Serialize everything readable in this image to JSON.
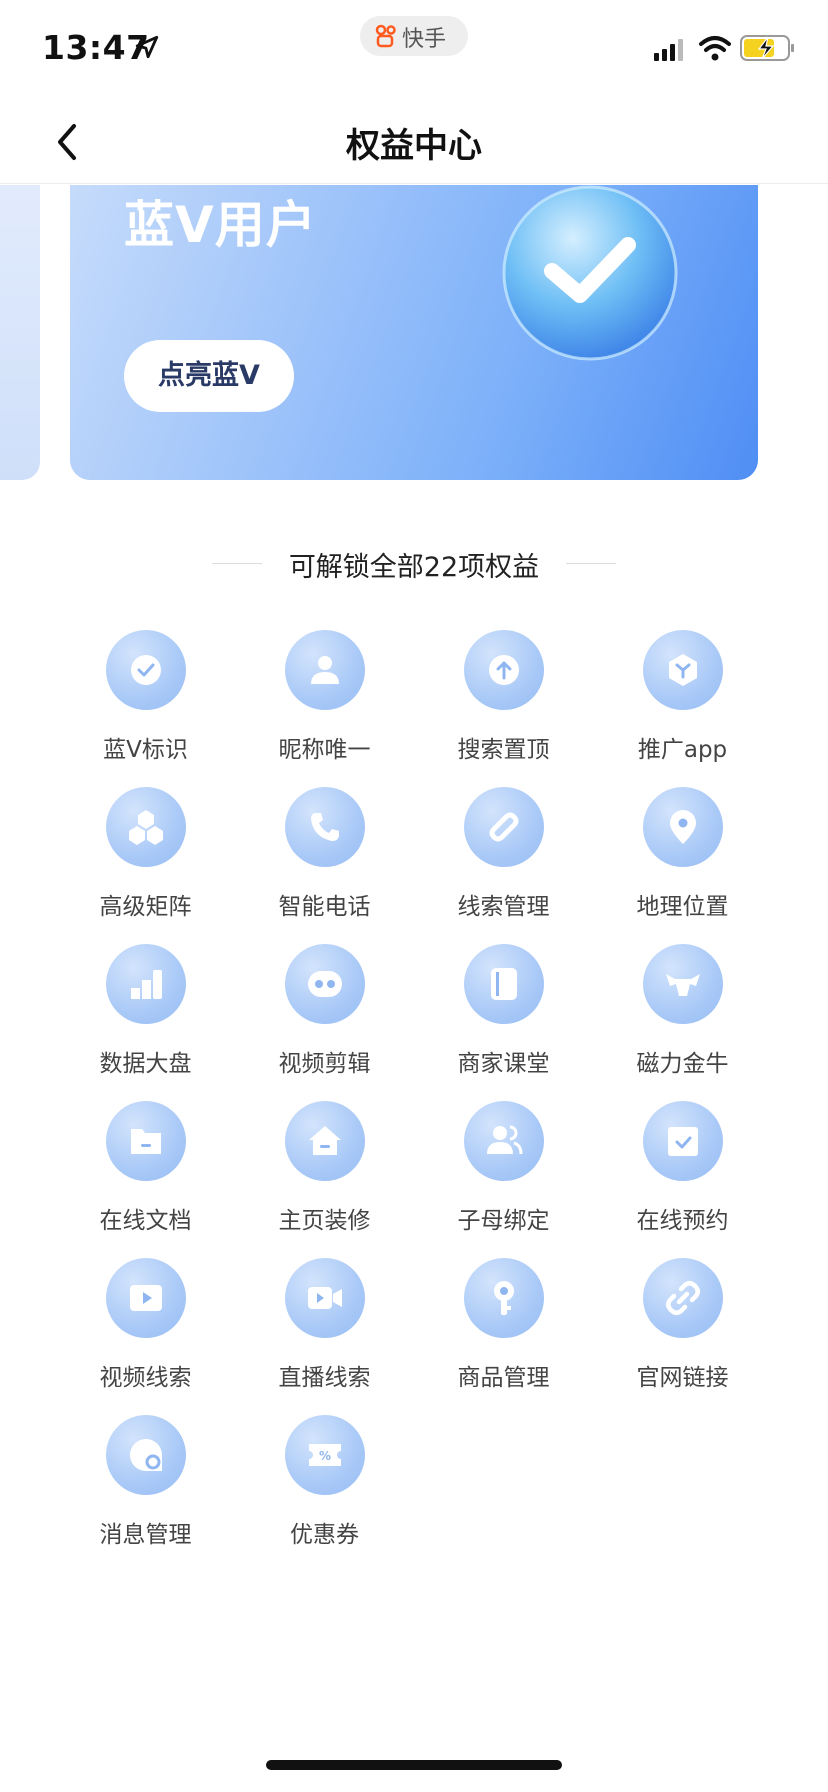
{
  "status_bar": {
    "time": "13:47",
    "app_name": "快手"
  },
  "nav": {
    "title": "权益中心"
  },
  "banner": {
    "title": "蓝V用户",
    "button_label": "点亮蓝V"
  },
  "benefits": {
    "header": "可解锁全部22项权益",
    "items": [
      {
        "label": "蓝V标识",
        "icon": "check-circle-icon"
      },
      {
        "label": "昵称唯一",
        "icon": "user-icon"
      },
      {
        "label": "搜索置顶",
        "icon": "arrow-up-icon"
      },
      {
        "label": "推广app",
        "icon": "box-icon"
      },
      {
        "label": "高级矩阵",
        "icon": "cubes-icon"
      },
      {
        "label": "智能电话",
        "icon": "phone-icon"
      },
      {
        "label": "线索管理",
        "icon": "link-chain-icon"
      },
      {
        "label": "地理位置",
        "icon": "location-pin-icon"
      },
      {
        "label": "数据大盘",
        "icon": "bar-chart-icon"
      },
      {
        "label": "视频剪辑",
        "icon": "film-reel-icon"
      },
      {
        "label": "商家课堂",
        "icon": "book-icon"
      },
      {
        "label": "磁力金牛",
        "icon": "bull-icon"
      },
      {
        "label": "在线文档",
        "icon": "folder-icon"
      },
      {
        "label": "主页装修",
        "icon": "home-icon"
      },
      {
        "label": "子母绑定",
        "icon": "users-icon"
      },
      {
        "label": "在线预约",
        "icon": "calendar-check-icon"
      },
      {
        "label": "视频线索",
        "icon": "play-icon"
      },
      {
        "label": "直播线索",
        "icon": "video-camera-icon"
      },
      {
        "label": "商品管理",
        "icon": "key-icon"
      },
      {
        "label": "官网链接",
        "icon": "link-icon"
      },
      {
        "label": "消息管理",
        "icon": "chat-gear-icon"
      },
      {
        "label": "优惠券",
        "icon": "coupon-icon"
      }
    ]
  },
  "colors": {
    "accent_blue": "#4f8ef4",
    "icon_bg": "#a9c9f7"
  }
}
